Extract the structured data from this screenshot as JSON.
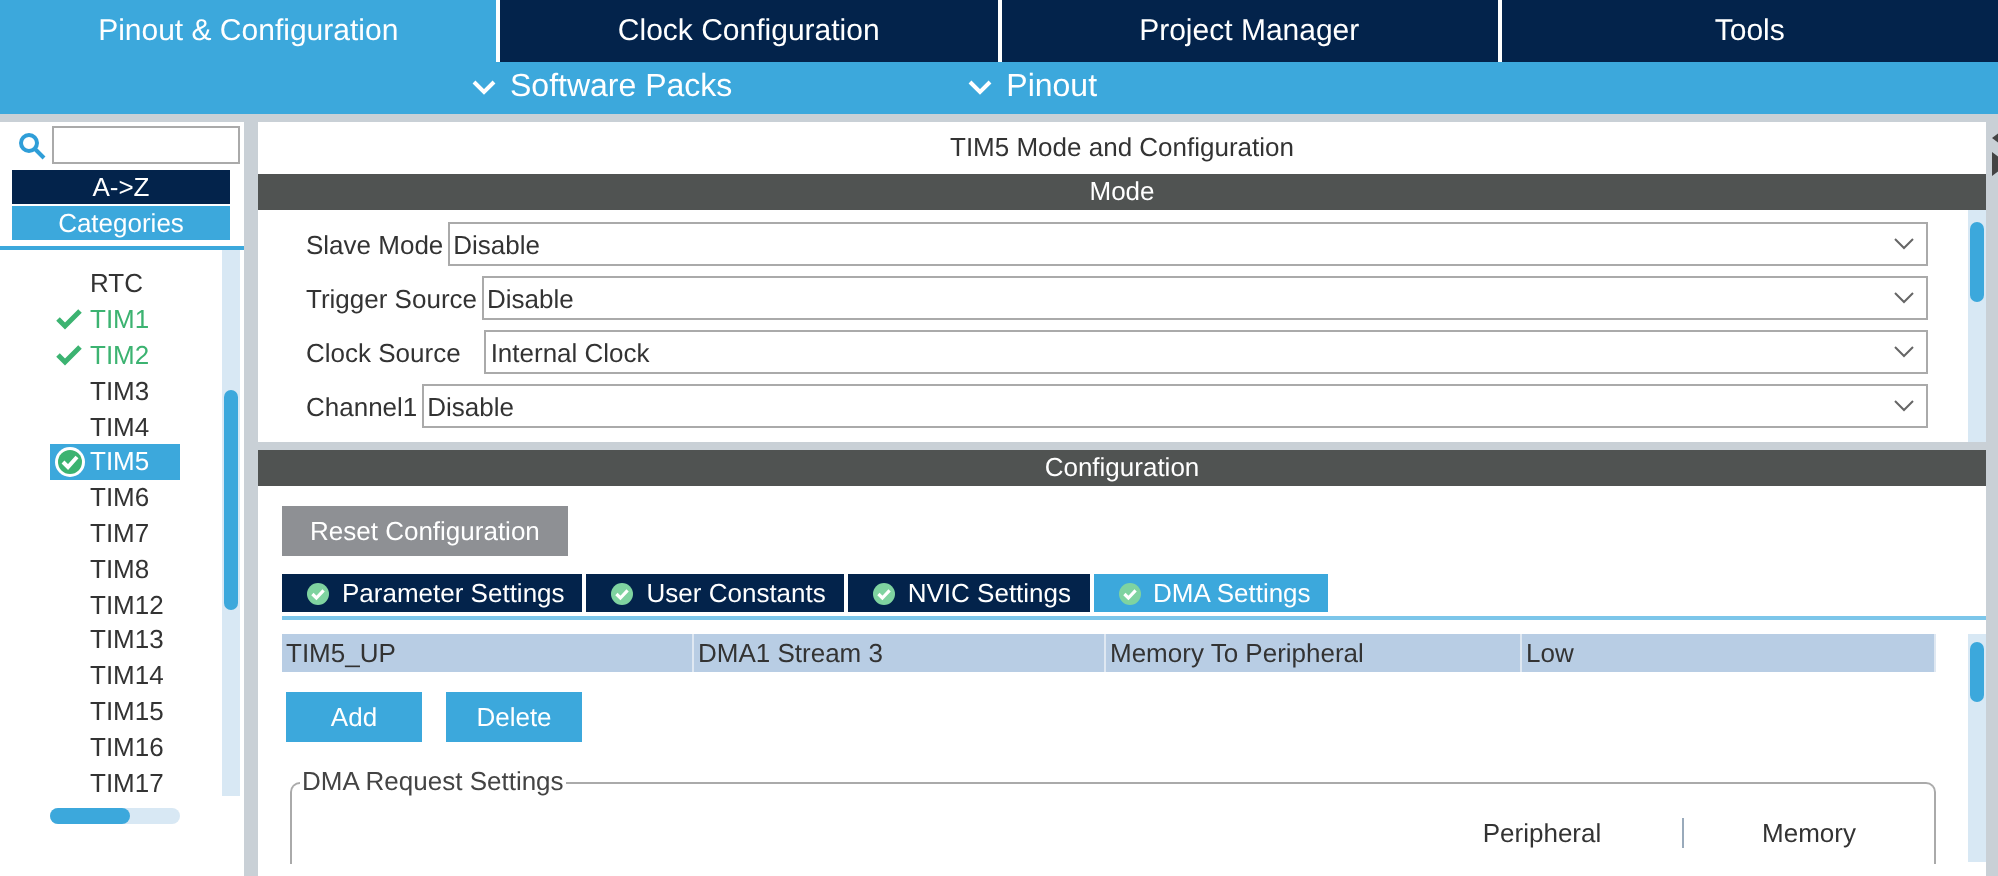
{
  "top_tabs": [
    {
      "label": "Pinout & Configuration",
      "selected": true
    },
    {
      "label": "Clock Configuration",
      "selected": false
    },
    {
      "label": "Project Manager",
      "selected": false
    },
    {
      "label": "Tools",
      "selected": false
    }
  ],
  "sub_menu": [
    {
      "label": "Software Packs"
    },
    {
      "label": "Pinout"
    }
  ],
  "sidebar": {
    "sort_buttons": [
      {
        "label": "A->Z",
        "selected": false
      },
      {
        "label": "Categories",
        "selected": true
      }
    ],
    "items": [
      {
        "label": "RTC",
        "checked": false,
        "selected": false
      },
      {
        "label": "TIM1",
        "checked": true,
        "selected": false
      },
      {
        "label": "TIM2",
        "checked": true,
        "selected": false
      },
      {
        "label": "TIM3",
        "checked": false,
        "selected": false
      },
      {
        "label": "TIM4",
        "checked": false,
        "selected": false
      },
      {
        "label": "TIM5",
        "checked": true,
        "selected": true
      },
      {
        "label": "TIM6",
        "checked": false,
        "selected": false
      },
      {
        "label": "TIM7",
        "checked": false,
        "selected": false
      },
      {
        "label": "TIM8",
        "checked": false,
        "selected": false
      },
      {
        "label": "TIM12",
        "checked": false,
        "selected": false
      },
      {
        "label": "TIM13",
        "checked": false,
        "selected": false
      },
      {
        "label": "TIM14",
        "checked": false,
        "selected": false
      },
      {
        "label": "TIM15",
        "checked": false,
        "selected": false
      },
      {
        "label": "TIM16",
        "checked": false,
        "selected": false
      },
      {
        "label": "TIM17",
        "checked": false,
        "selected": false
      }
    ]
  },
  "panel": {
    "title": "TIM5 Mode and Configuration",
    "mode_header": "Mode",
    "mode_fields": [
      {
        "label": "Slave Mode",
        "value": "Disable"
      },
      {
        "label": "Trigger Source",
        "value": "Disable"
      },
      {
        "label": "Clock Source",
        "value": "Internal Clock"
      },
      {
        "label": "Channel1",
        "value": "Disable"
      }
    ],
    "config_header": "Configuration",
    "reset_button": "Reset Configuration",
    "config_tabs": [
      {
        "label": "Parameter Settings",
        "selected": false
      },
      {
        "label": "User Constants",
        "selected": false
      },
      {
        "label": "NVIC Settings",
        "selected": false
      },
      {
        "label": "DMA Settings",
        "selected": true
      }
    ],
    "dma_rows": [
      {
        "cells": [
          "TIM5_UP",
          "DMA1 Stream 3",
          "Memory To Peripheral",
          "Low"
        ],
        "selected": true
      }
    ],
    "dma_buttons": [
      "Add",
      "Delete"
    ],
    "request_settings": {
      "title": "DMA Request Settings",
      "columns": [
        "Peripheral",
        "Memory"
      ]
    }
  }
}
